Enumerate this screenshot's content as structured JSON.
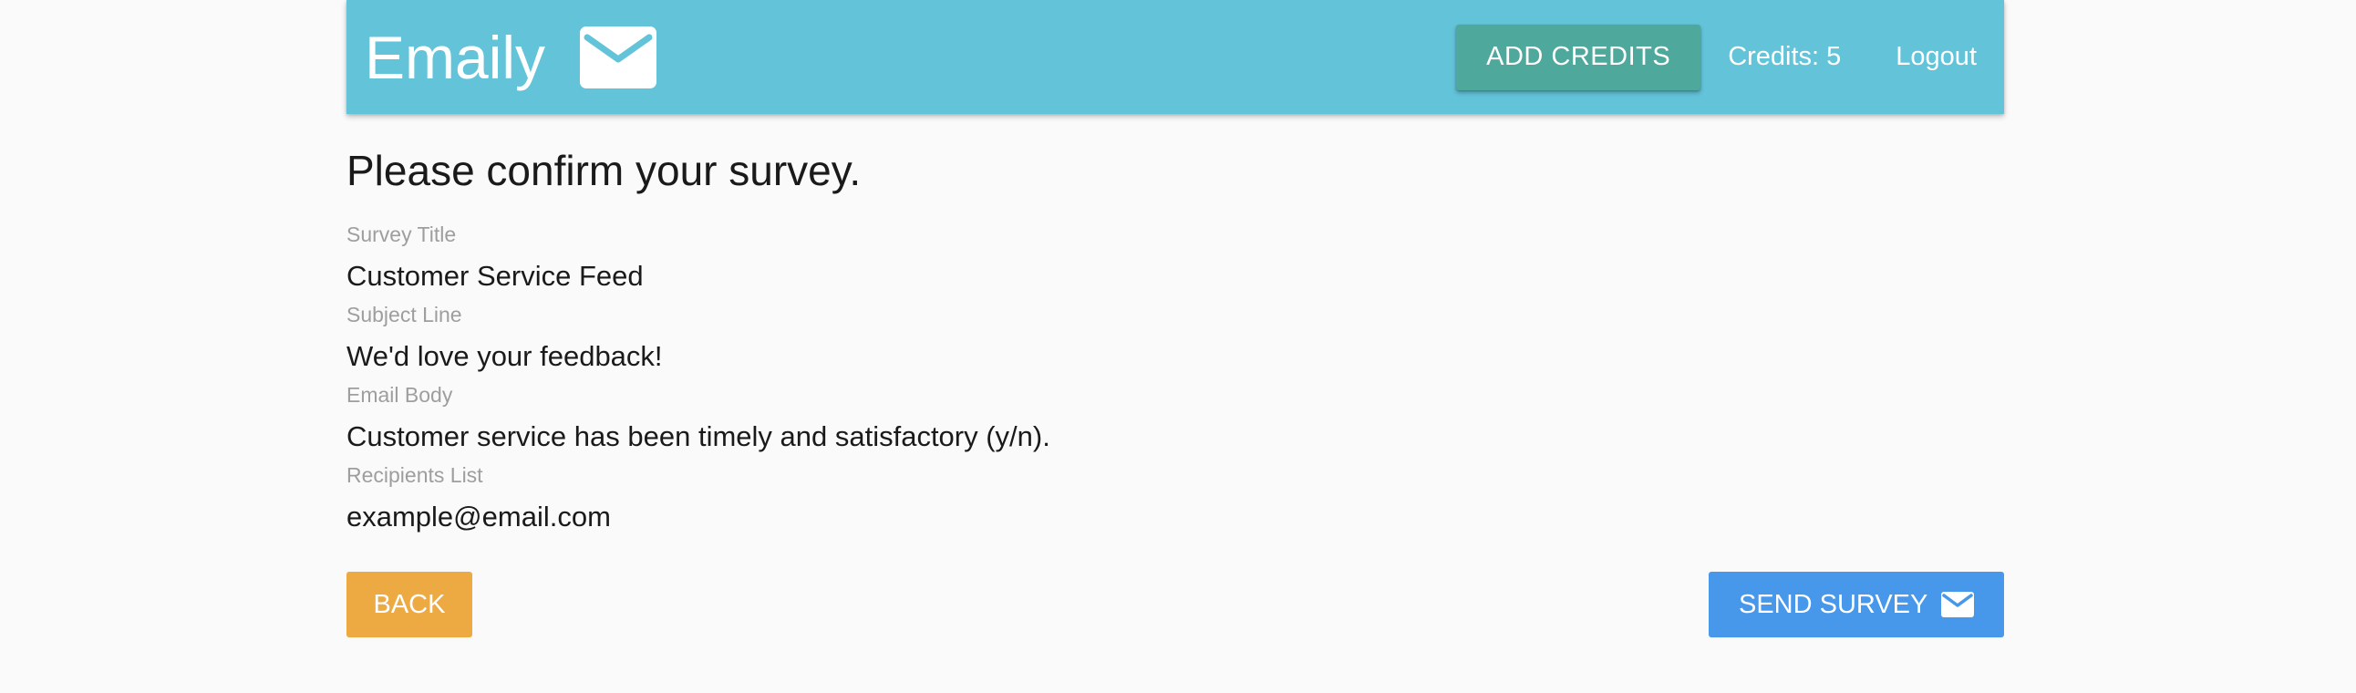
{
  "navbar": {
    "brand": "Emaily",
    "brand_icon": "mail-icon",
    "add_credits_label": "ADD CREDITS",
    "credits_text": "Credits: 5",
    "logout_label": "Logout",
    "background_color": "#62c3d9",
    "add_credits_color": "#4fa89c"
  },
  "form_review": {
    "title": "Please confirm your survey.",
    "fields": [
      {
        "label": "Survey Title",
        "value": "Customer Service Feed"
      },
      {
        "label": "Subject Line",
        "value": "We'd love your feedback!"
      },
      {
        "label": "Email Body",
        "value": "Customer service has been timely and satisfactory (y/n)."
      },
      {
        "label": "Recipients List",
        "value": "example@email.com"
      }
    ]
  },
  "actions": {
    "back_label": "BACK",
    "back_color": "#eeaa42",
    "send_label": "SEND SURVEY",
    "send_icon": "mail-icon",
    "send_color": "#4797ea"
  }
}
